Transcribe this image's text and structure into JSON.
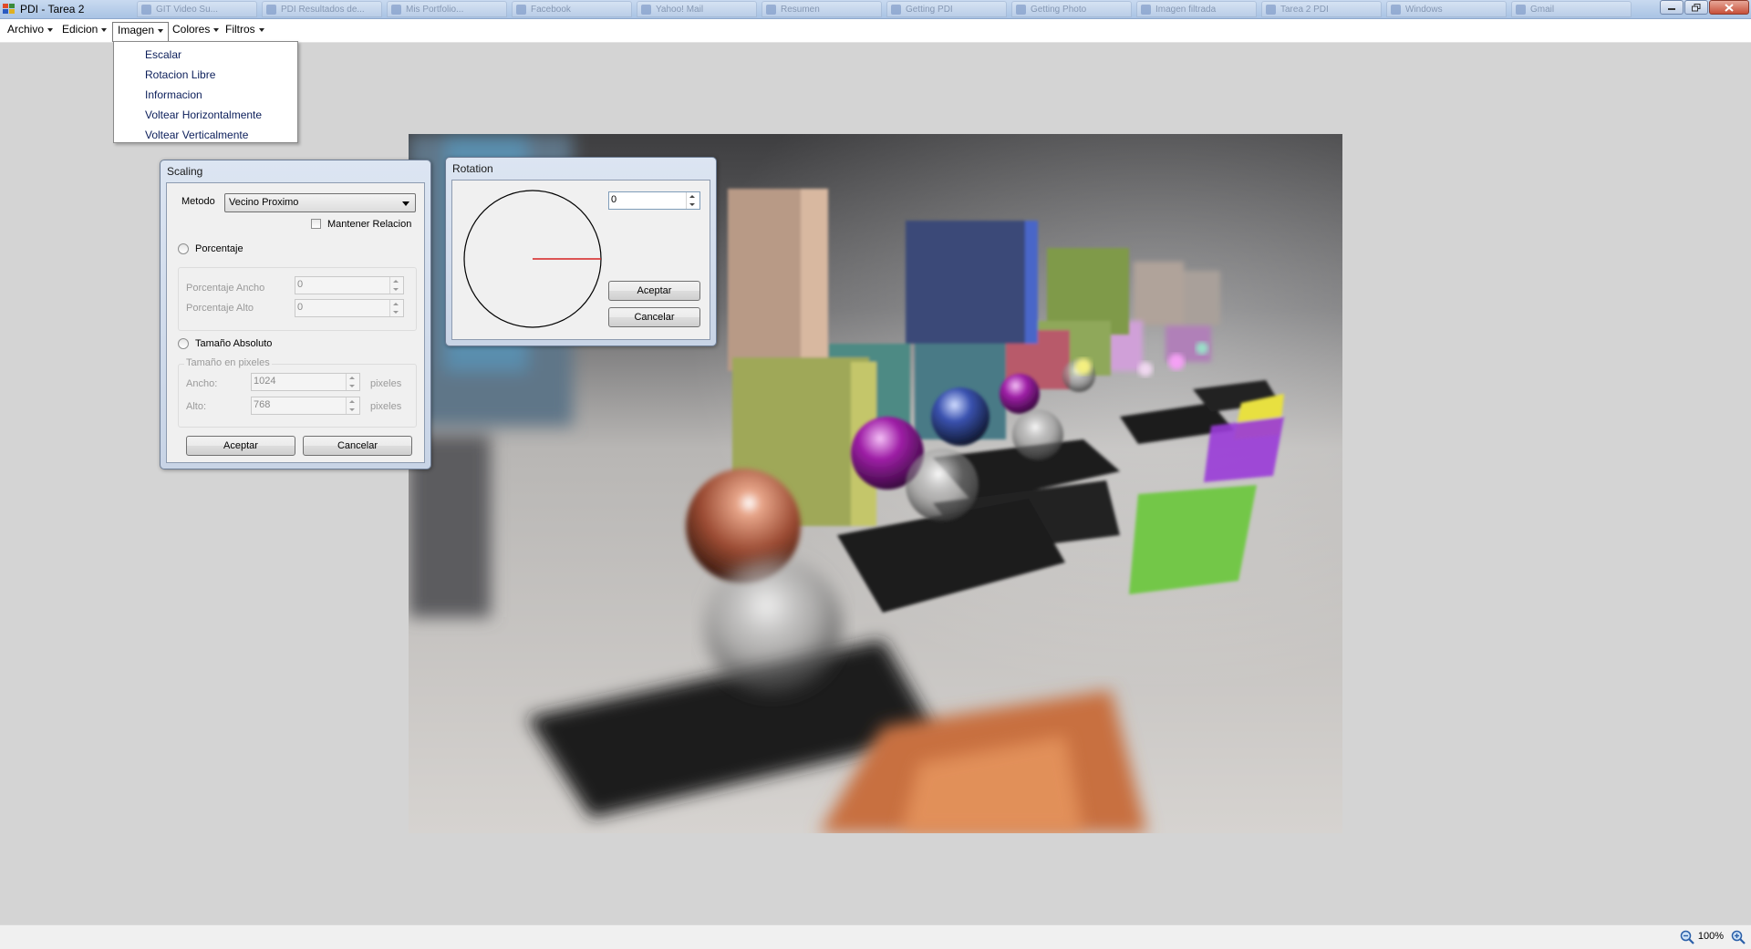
{
  "window": {
    "title": "PDI - Tarea 2",
    "background_tabs": [
      "GIT Video Su...",
      "PDI Resultados de...",
      "Mis Portfolio...",
      "Facebook",
      "Yahoo! Mail",
      "Resumen",
      "Getting PDI",
      "Getting Photo",
      "Imagen filtrada",
      "Tarea 2 PDI",
      "Windows",
      "Gmail"
    ]
  },
  "menubar": {
    "items": [
      "Archivo",
      "Edicion",
      "Imagen",
      "Colores",
      "Filtros"
    ],
    "open_item": "Imagen"
  },
  "imagen_menu": {
    "items": [
      "Escalar",
      "Rotacion Libre",
      "Informacion",
      "Voltear Horizontalmente",
      "Voltear Verticalmente"
    ]
  },
  "scaling_dialog": {
    "title": "Scaling",
    "metodo_label": "Metodo",
    "metodo_value": "Vecino Proximo",
    "mantener_relacion_label": "Mantener Relacion",
    "mantener_relacion_checked": false,
    "porcentaje_label": "Porcentaje",
    "porcentaje_ancho_label": "Porcentaje Ancho",
    "porcentaje_ancho_value": "0",
    "porcentaje_alto_label": "Porcentaje Alto",
    "porcentaje_alto_value": "0",
    "tamano_absoluto_label": "Tamaño Absoluto",
    "tamano_group_label": "Tamaño en pixeles",
    "ancho_label": "Ancho:",
    "ancho_value": "1024",
    "alto_label": "Alto:",
    "alto_value": "768",
    "unit_label": "pixeles",
    "aceptar_label": "Aceptar",
    "cancelar_label": "Cancelar"
  },
  "rotation_dialog": {
    "title": "Rotation",
    "angle_value": "0",
    "aceptar_label": "Aceptar",
    "cancelar_label": "Cancelar"
  },
  "statusbar": {
    "zoom": "100%"
  },
  "colors": {
    "workspace": "#d4d4d4",
    "menu_text": "#0b1e5a",
    "rotation_indicator": "#d62020"
  }
}
